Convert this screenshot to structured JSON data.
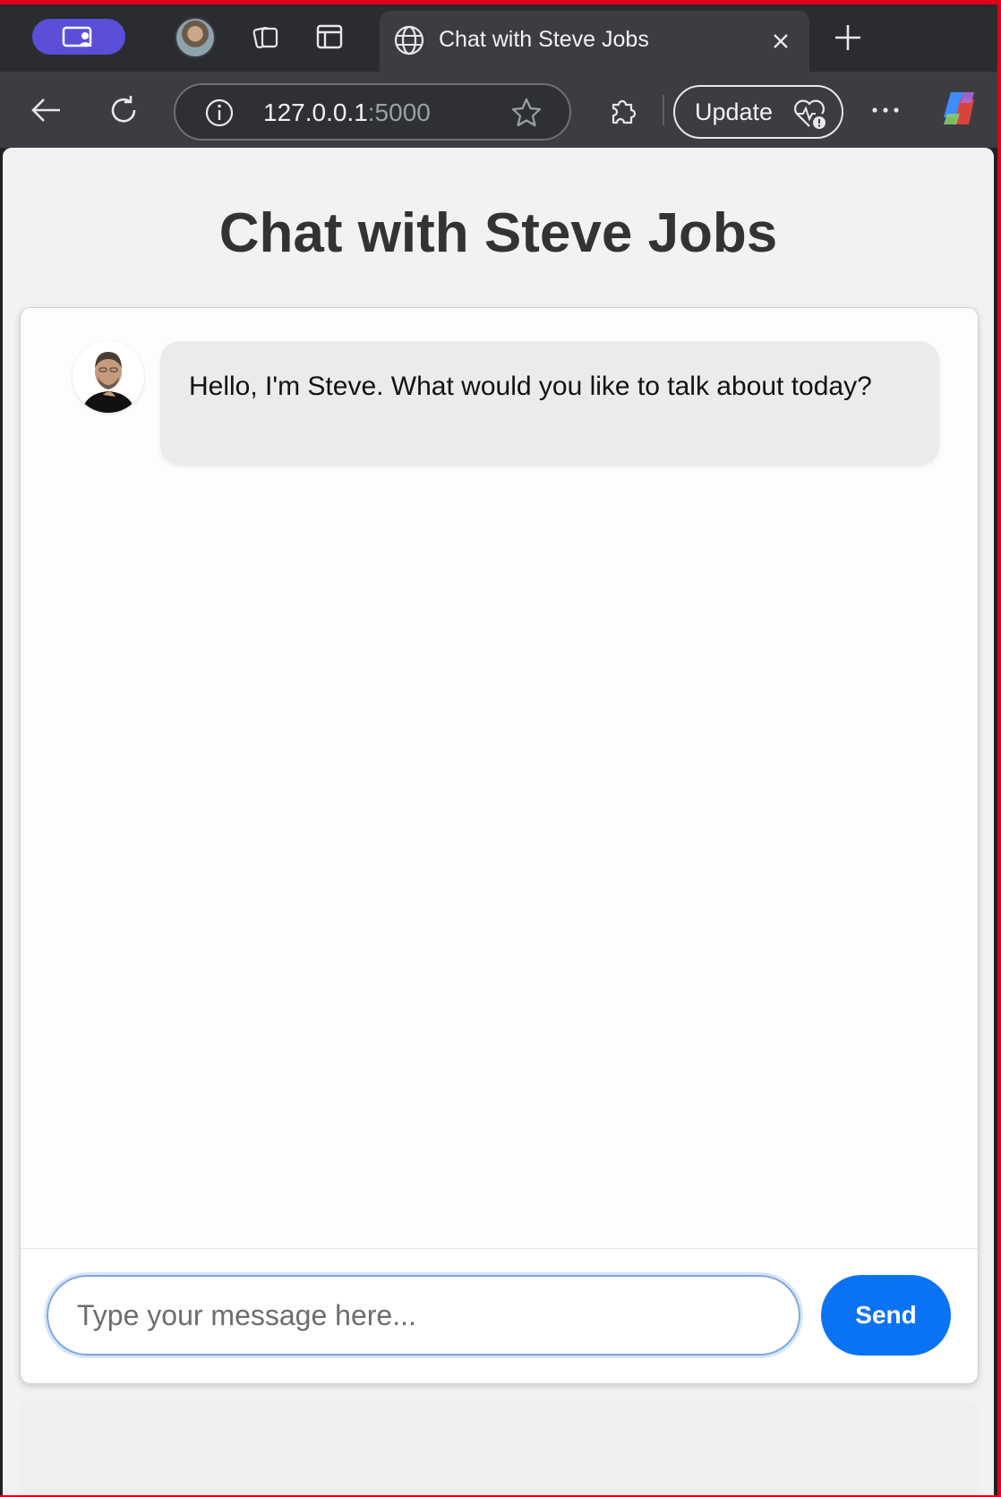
{
  "browser": {
    "active_tab": {
      "title": "Chat with Steve Jobs"
    },
    "address_bar": {
      "host": "127.0.0.1",
      "port": ":5000"
    },
    "update_button": {
      "label": "Update"
    },
    "icons": [
      "workspaces-icon",
      "profile-avatar",
      "collections-icon",
      "sidebar-icon",
      "globe-icon",
      "close-icon",
      "new-tab-icon",
      "back-icon",
      "refresh-icon",
      "info-icon",
      "favorite-star-icon",
      "extensions-icon",
      "heartbeat-icon",
      "more-icon",
      "copilot-icon"
    ]
  },
  "page": {
    "title": "Chat with Steve Jobs",
    "messages": [
      {
        "sender": "bot",
        "text": "Hello, I'm Steve. What would you like to talk about today?"
      }
    ],
    "input": {
      "placeholder": "Type your message here...",
      "value": ""
    },
    "send_label": "Send"
  },
  "colors": {
    "send_button": "#0a73f5",
    "bubble_bg": "#ebebeb",
    "title": "#333333",
    "workspace_pill": "#5a4fd6"
  }
}
